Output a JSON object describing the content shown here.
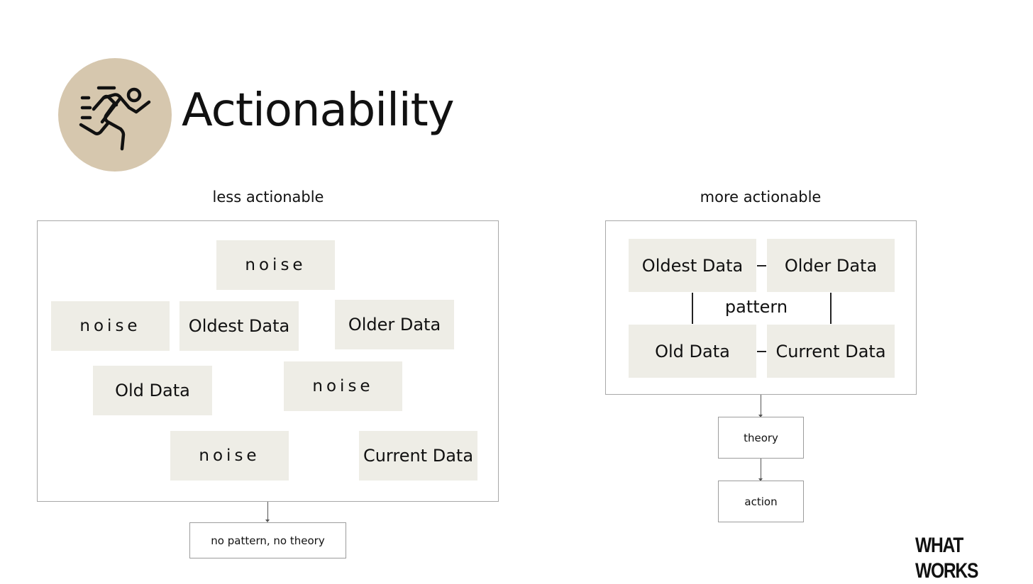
{
  "header": {
    "icon": "running-person-icon",
    "title": "Actionability"
  },
  "left_panel": {
    "label": "less actionable",
    "tiles": [
      {
        "text": "noise",
        "kind": "noise"
      },
      {
        "text": "noise",
        "kind": "noise"
      },
      {
        "text": "Oldest Data",
        "kind": "data"
      },
      {
        "text": "Older Data",
        "kind": "data"
      },
      {
        "text": "Old Data",
        "kind": "data"
      },
      {
        "text": "noise",
        "kind": "noise"
      },
      {
        "text": "noise",
        "kind": "noise"
      },
      {
        "text": "Current Data",
        "kind": "data"
      }
    ],
    "outcome": "no pattern, no theory"
  },
  "right_panel": {
    "label": "more actionable",
    "tiles": [
      {
        "text": "Oldest Data"
      },
      {
        "text": "Older Data"
      },
      {
        "text": "Old Data"
      },
      {
        "text": "Current Data"
      }
    ],
    "center_label": "pattern",
    "steps": [
      "theory",
      "action"
    ]
  },
  "brand": "WHAT WORKS",
  "colors": {
    "icon_circle": "#d6c7ae",
    "tile_background": "#eeede6",
    "frame_border": "#a8a8a8"
  }
}
